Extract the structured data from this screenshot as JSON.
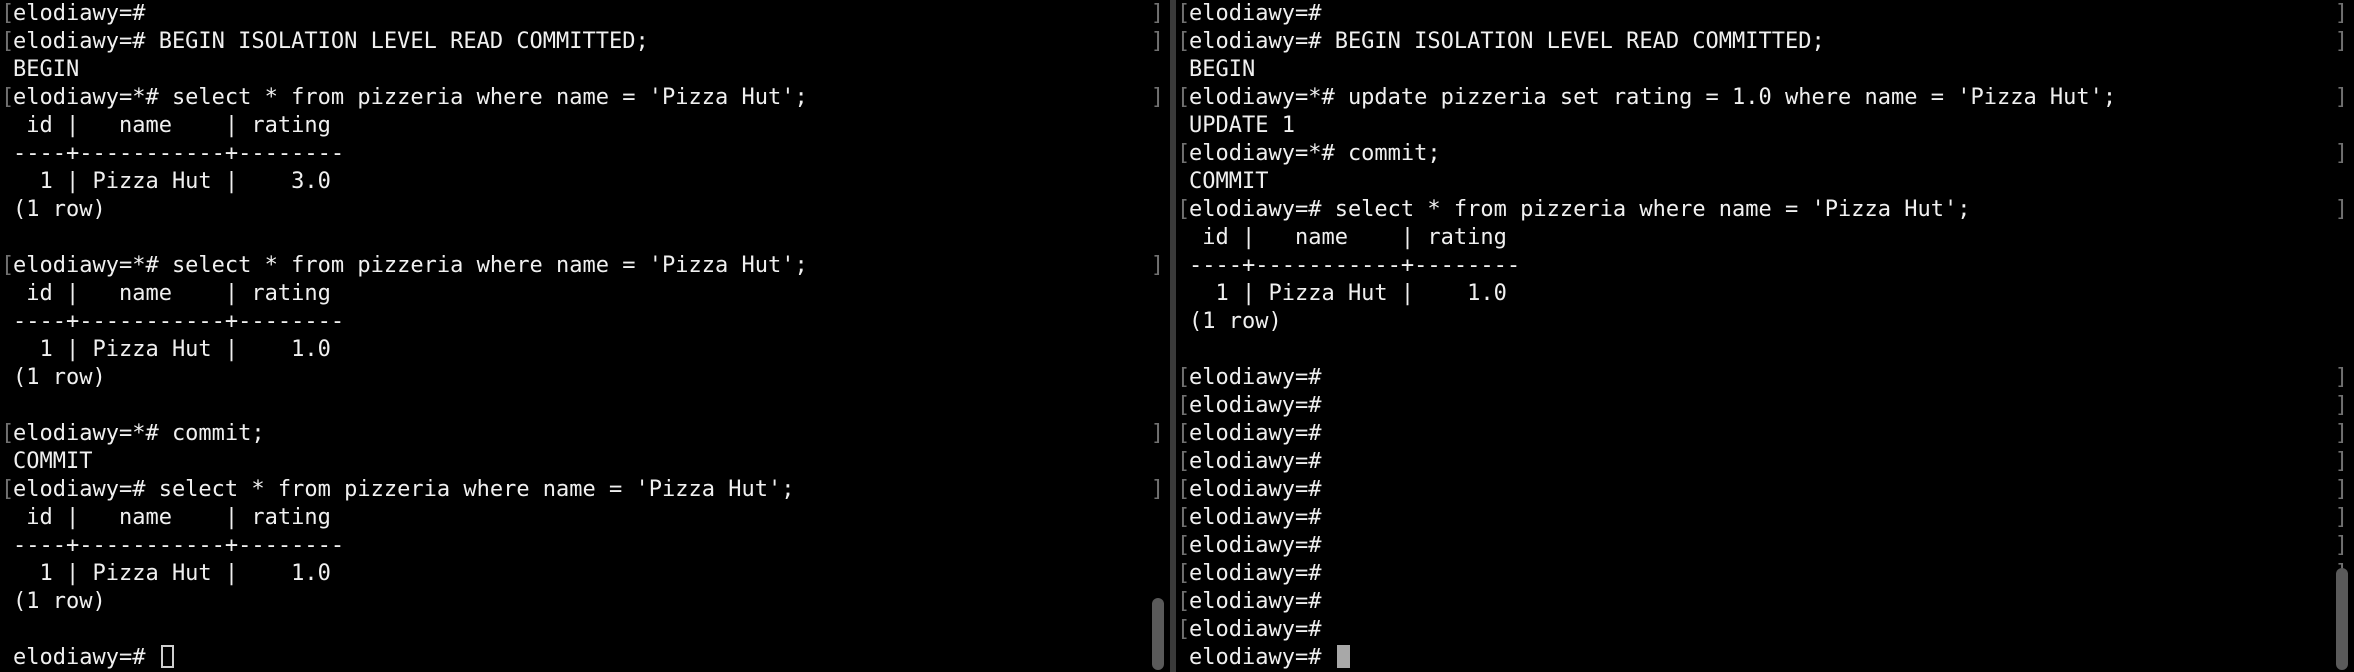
{
  "colors": {
    "background": "#000000",
    "text": "#f0f0f0",
    "divider": "#3a3a3a",
    "scrollbar": "#5a5a5a"
  },
  "panes": {
    "left": {
      "lines": [
        {
          "text": "elodiawy=#",
          "marked": true
        },
        {
          "text": "elodiawy=# BEGIN ISOLATION LEVEL READ COMMITTED;",
          "marked": true
        },
        {
          "text": "BEGIN",
          "marked": false
        },
        {
          "text": "elodiawy=*# select * from pizzeria where name = 'Pizza Hut';",
          "marked": true
        },
        {
          "text": " id |   name    | rating",
          "marked": false
        },
        {
          "text": "----+-----------+--------",
          "marked": false
        },
        {
          "text": "  1 | Pizza Hut |    3.0",
          "marked": false
        },
        {
          "text": "(1 row)",
          "marked": false
        },
        {
          "text": "",
          "marked": false
        },
        {
          "text": "elodiawy=*# select * from pizzeria where name = 'Pizza Hut';",
          "marked": true
        },
        {
          "text": " id |   name    | rating",
          "marked": false
        },
        {
          "text": "----+-----------+--------",
          "marked": false
        },
        {
          "text": "  1 | Pizza Hut |    1.0",
          "marked": false
        },
        {
          "text": "(1 row)",
          "marked": false
        },
        {
          "text": "",
          "marked": false
        },
        {
          "text": "elodiawy=*# commit;",
          "marked": true
        },
        {
          "text": "COMMIT",
          "marked": false
        },
        {
          "text": "elodiawy=# select * from pizzeria where name = 'Pizza Hut';",
          "marked": true
        },
        {
          "text": " id |   name    | rating",
          "marked": false
        },
        {
          "text": "----+-----------+--------",
          "marked": false
        },
        {
          "text": "  1 | Pizza Hut |    1.0",
          "marked": false
        },
        {
          "text": "(1 row)",
          "marked": false
        },
        {
          "text": "",
          "marked": false
        }
      ],
      "prompt": "elodiawy=# ",
      "cursor": "hollow"
    },
    "right": {
      "lines": [
        {
          "text": "elodiawy=#",
          "marked": true
        },
        {
          "text": "elodiawy=# BEGIN ISOLATION LEVEL READ COMMITTED;",
          "marked": true
        },
        {
          "text": "BEGIN",
          "marked": false
        },
        {
          "text": "elodiawy=*# update pizzeria set rating = 1.0 where name = 'Pizza Hut';",
          "marked": true
        },
        {
          "text": "UPDATE 1",
          "marked": false
        },
        {
          "text": "elodiawy=*# commit;",
          "marked": true
        },
        {
          "text": "COMMIT",
          "marked": false
        },
        {
          "text": "elodiawy=# select * from pizzeria where name = 'Pizza Hut';",
          "marked": true
        },
        {
          "text": " id |   name    | rating",
          "marked": false
        },
        {
          "text": "----+-----------+--------",
          "marked": false
        },
        {
          "text": "  1 | Pizza Hut |    1.0",
          "marked": false
        },
        {
          "text": "(1 row)",
          "marked": false
        },
        {
          "text": "",
          "marked": false
        },
        {
          "text": "elodiawy=#",
          "marked": true
        },
        {
          "text": "elodiawy=#",
          "marked": true
        },
        {
          "text": "elodiawy=#",
          "marked": true
        },
        {
          "text": "elodiawy=#",
          "marked": true
        },
        {
          "text": "elodiawy=#",
          "marked": true
        },
        {
          "text": "elodiawy=#",
          "marked": true
        },
        {
          "text": "elodiawy=#",
          "marked": true
        },
        {
          "text": "elodiawy=#",
          "marked": true
        },
        {
          "text": "elodiawy=#",
          "marked": true
        },
        {
          "text": "elodiawy=#",
          "marked": true
        }
      ],
      "prompt": "elodiawy=# ",
      "cursor": "solid"
    }
  }
}
